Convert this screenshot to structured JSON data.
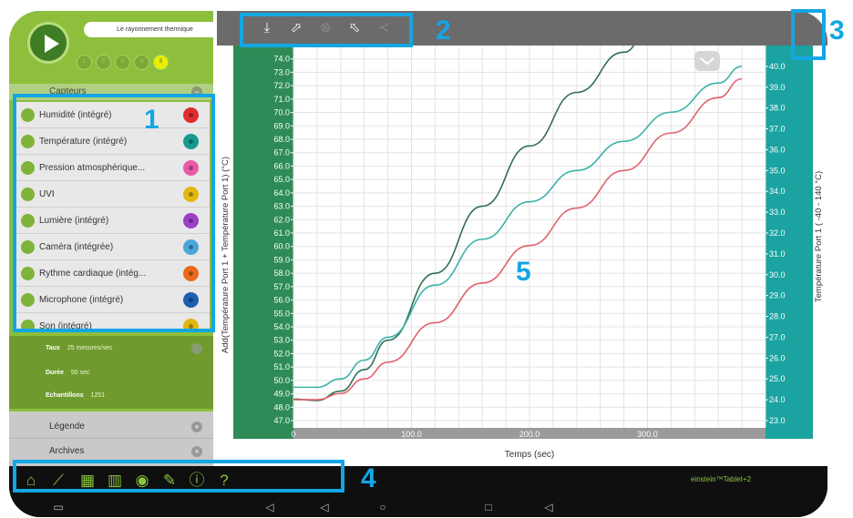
{
  "experiment": {
    "title": "Le rayonnement thermique"
  },
  "steps": [
    "1",
    "2",
    "3",
    "4",
    "5"
  ],
  "sidebar": {
    "sensors_header": "Capteurs",
    "sensors": [
      {
        "label": "Humidité (intégré)",
        "color": "#e02d2d",
        "checked": true
      },
      {
        "label": "Température (intégré)",
        "color": "#169a8f",
        "checked": true
      },
      {
        "label": "Pression atmosphérique...",
        "color": "#e85aa8",
        "checked": true
      },
      {
        "label": "UVI",
        "color": "#e3b70f",
        "checked": true
      },
      {
        "label": "Lumière (intégré)",
        "color": "#9c3fc7",
        "checked": true
      },
      {
        "label": "Caméra (intégrée)",
        "color": "#4aa6d9",
        "checked": true
      },
      {
        "label": "Rythme cardiaque (intég...",
        "color": "#e86a1a",
        "checked": true
      },
      {
        "label": "Microphone (intégré)",
        "color": "#1e5fb0",
        "checked": true
      },
      {
        "label": "Son (intégré)",
        "color": "#e3b70f",
        "checked": true
      }
    ],
    "settings": [
      {
        "key": "Taux",
        "value": "25 mesures/sec"
      },
      {
        "key": "Durée",
        "value": "50 sec"
      },
      {
        "key": "Echantillons",
        "value": "1251"
      }
    ],
    "legend_label": "Légende",
    "archives_label": "Archives"
  },
  "toolbar": {
    "icons": [
      "download-icon",
      "export-icon",
      "delete-icon",
      "import-icon",
      "share-icon"
    ],
    "function_icon": "ƒ"
  },
  "callouts": [
    "1",
    "2",
    "3",
    "4",
    "5"
  ],
  "bottom_nav": {
    "icons": [
      "home-icon",
      "graph-icon",
      "table-icon",
      "bar-chart-icon",
      "navigate-icon",
      "pen-icon",
      "info-icon",
      "help-icon"
    ],
    "brand": "einstein™Tablet+2"
  },
  "chart_data": {
    "type": "line",
    "xlabel": "Temps (sec)",
    "ylabel_left": "Add(Température Port 1 + Température Port 1) (°C)",
    "ylabel_right": "Température Port 1 ( -40 - 140 °C)",
    "xlim": [
      0,
      400
    ],
    "ylim_left": [
      47.0,
      75.0
    ],
    "ylim_right": [
      23.0,
      41.0
    ],
    "x_ticks": [
      "0",
      "100.0",
      "200.0",
      "300.0"
    ],
    "y_ticks_left": [
      "47.0",
      "48.0",
      "49.0",
      "50.0",
      "51.0",
      "52.0",
      "53.0",
      "54.0",
      "55.0",
      "56.0",
      "57.0",
      "58.0",
      "59.0",
      "60.0",
      "61.0",
      "62.0",
      "63.0",
      "64.0",
      "65.0",
      "66.0",
      "67.0",
      "68.0",
      "69.0",
      "70.0",
      "71.0",
      "72.0",
      "73.0",
      "74.0"
    ],
    "y_ticks_right": [
      "23.0",
      "24.0",
      "25.0",
      "26.0",
      "27.0",
      "28.0",
      "29.0",
      "30.0",
      "31.0",
      "32.0",
      "33.0",
      "34.0",
      "35.0",
      "36.0",
      "37.0",
      "38.0",
      "39.0",
      "40.0"
    ],
    "grid": true,
    "series": [
      {
        "color": "#2f6f55",
        "axis": "left",
        "x": [
          0,
          20,
          40,
          60,
          80,
          120,
          160,
          200,
          240,
          280,
          300
        ],
        "y": [
          48.6,
          48.5,
          49.2,
          50.8,
          53.0,
          58.0,
          63.0,
          67.5,
          71.5,
          74.5,
          76.0
        ]
      },
      {
        "color": "#3ab3a8",
        "axis": "right",
        "x": [
          0,
          20,
          40,
          60,
          80,
          120,
          160,
          200,
          240,
          280,
          320,
          360,
          380
        ],
        "y": [
          24.6,
          24.6,
          25.0,
          25.9,
          27.0,
          29.5,
          31.7,
          33.5,
          35.0,
          36.4,
          37.8,
          39.2,
          40.0
        ]
      },
      {
        "color": "#e0626b",
        "axis": "right",
        "x": [
          0,
          20,
          40,
          60,
          80,
          120,
          160,
          200,
          240,
          280,
          320,
          360,
          380
        ],
        "y": [
          24.0,
          24.0,
          24.3,
          25.0,
          25.8,
          27.7,
          29.6,
          31.4,
          33.2,
          35.0,
          36.8,
          38.5,
          39.4
        ]
      }
    ]
  }
}
